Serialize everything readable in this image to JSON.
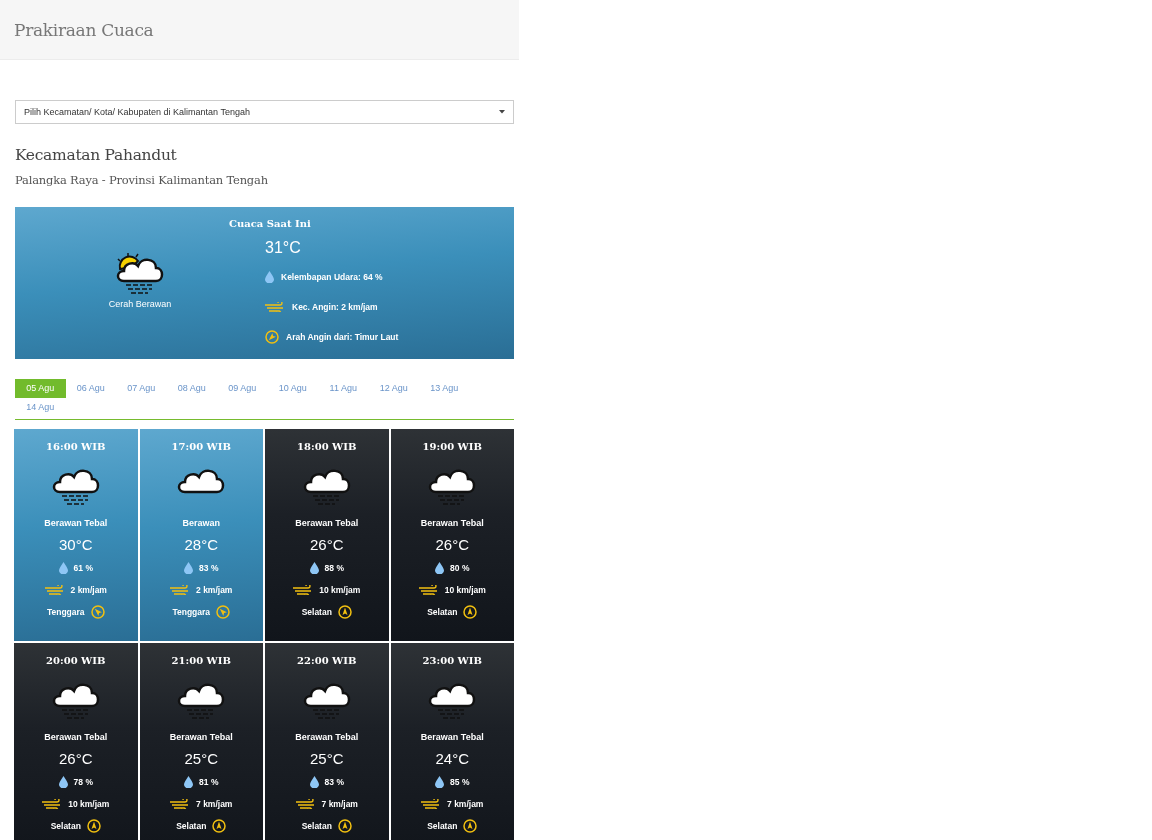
{
  "header": {
    "title": "Prakiraan Cuaca"
  },
  "location_select": {
    "value": "Pilih Kecamatan/ Kota/ Kabupaten di Kalimantan Tengah"
  },
  "location": {
    "title": "Kecamatan Pahandut",
    "subtitle": "Palangka Raya - Provinsi Kalimantan Tengah"
  },
  "current": {
    "heading": "Cuaca Saat Ini",
    "condition": {
      "label": "Cerah Berawan",
      "kind": "sunhaze"
    },
    "temperature": "31°C",
    "humidity": "Kelembapan Udara: 64 %",
    "wind_speed": "Kec. Angin: 2 km/jam",
    "wind_direction": {
      "label": "Arah Angin dari: Timur Laut",
      "kind": "northeast"
    }
  },
  "date_tabs": [
    {
      "label": "05 Agu",
      "selected": true
    },
    {
      "label": "06 Agu",
      "selected": false
    },
    {
      "label": "07 Agu",
      "selected": false
    },
    {
      "label": "08 Agu",
      "selected": false
    },
    {
      "label": "09 Agu",
      "selected": false
    },
    {
      "label": "10 Agu",
      "selected": false
    },
    {
      "label": "11 Agu",
      "selected": false
    },
    {
      "label": "12 Agu",
      "selected": false
    },
    {
      "label": "13 Agu",
      "selected": false
    },
    {
      "label": "14 Agu",
      "selected": false
    }
  ],
  "forecast": [
    {
      "kind": "day",
      "time": "16:00 WIB",
      "condition": {
        "label": "Berawan Tebal",
        "kind": "haze"
      },
      "temperature": "30°C",
      "humidity": "61 %",
      "wind_speed": "2 km/jam",
      "wind_direction": {
        "label": "Tenggara",
        "kind": "southeast"
      }
    },
    {
      "kind": "day",
      "time": "17:00 WIB",
      "condition": {
        "label": "Berawan",
        "kind": "cloud"
      },
      "temperature": "28°C",
      "humidity": "83 %",
      "wind_speed": "2 km/jam",
      "wind_direction": {
        "label": "Tenggara",
        "kind": "southeast"
      }
    },
    {
      "kind": "night",
      "time": "18:00 WIB",
      "condition": {
        "label": "Berawan Tebal",
        "kind": "haze"
      },
      "temperature": "26°C",
      "humidity": "88 %",
      "wind_speed": "10 km/jam",
      "wind_direction": {
        "label": "Selatan",
        "kind": "south"
      }
    },
    {
      "kind": "night",
      "time": "19:00 WIB",
      "condition": {
        "label": "Berawan Tebal",
        "kind": "haze"
      },
      "temperature": "26°C",
      "humidity": "80 %",
      "wind_speed": "10 km/jam",
      "wind_direction": {
        "label": "Selatan",
        "kind": "south"
      }
    },
    {
      "kind": "night",
      "time": "20:00 WIB",
      "condition": {
        "label": "Berawan Tebal",
        "kind": "haze"
      },
      "temperature": "26°C",
      "humidity": "78 %",
      "wind_speed": "10 km/jam",
      "wind_direction": {
        "label": "Selatan",
        "kind": "south"
      }
    },
    {
      "kind": "night",
      "time": "21:00 WIB",
      "condition": {
        "label": "Berawan Tebal",
        "kind": "haze"
      },
      "temperature": "25°C",
      "humidity": "81 %",
      "wind_speed": "7 km/jam",
      "wind_direction": {
        "label": "Selatan",
        "kind": "south"
      }
    },
    {
      "kind": "night",
      "time": "22:00 WIB",
      "condition": {
        "label": "Berawan Tebal",
        "kind": "haze"
      },
      "temperature": "25°C",
      "humidity": "83 %",
      "wind_speed": "7 km/jam",
      "wind_direction": {
        "label": "Selatan",
        "kind": "south"
      }
    },
    {
      "kind": "night",
      "time": "23:00 WIB",
      "condition": {
        "label": "Berawan Tebal",
        "kind": "haze"
      },
      "temperature": "24°C",
      "humidity": "85 %",
      "wind_speed": "7 km/jam",
      "wind_direction": {
        "label": "Selatan",
        "kind": "south"
      }
    }
  ]
}
